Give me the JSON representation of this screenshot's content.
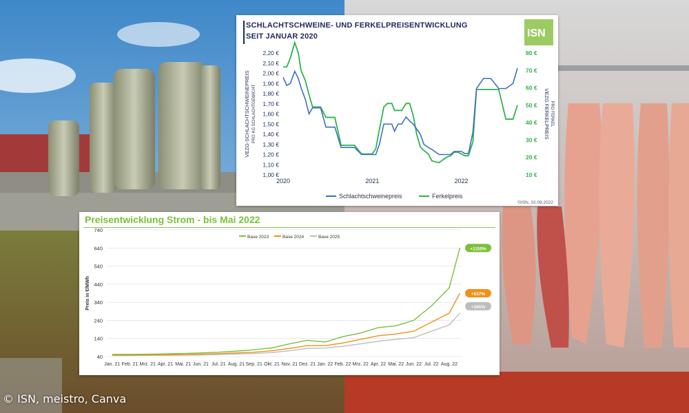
{
  "credit": "© ISN, meistro, Canva",
  "colors": {
    "blue": "#3b6fc4",
    "green": "#2db34a",
    "c2023": "#7bbf3a",
    "c2024": "#f0901a",
    "c2025": "#bdbdbd"
  },
  "chart_data": [
    {
      "type": "line",
      "title_line1": "SCHLACHTSCHWEINE- UND FERKELPREISENTWICKLUNG",
      "title_line2": "SEIT JANUAR 2020",
      "logo_text": "ISN",
      "ylabel_left": "VEZG-SCHLACHTSCHWEINEPREIS",
      "ylabel_left_sub": "PRO KG SCHLACHTGEWICHT",
      "ylabel_right": "VEZG FERKELPREIS",
      "ylabel_right_sub": "PRO FERKEL",
      "y_left_ticks": [
        "2,20 €",
        "2,10 €",
        "2,00 €",
        "1,90 €",
        "1,80 €",
        "1,70 €",
        "1,60 €",
        "1,50 €",
        "1,40 €",
        "1,30 €",
        "1,20 €",
        "1,10 €",
        "1,00 €"
      ],
      "y_right_ticks": [
        "80 €",
        "70 €",
        "60 €",
        "50 €",
        "40 €",
        "30 €",
        "20 €",
        "10 €"
      ],
      "x_ticks": [
        "2020",
        "2021",
        "2022"
      ],
      "ylim_left": [
        1.0,
        2.2
      ],
      "ylim_right": [
        10,
        80
      ],
      "legend": [
        "Schlachtschweinepreis",
        "Ferkelpreis"
      ],
      "source_note": "©ISN, 02.09.2022",
      "x": [
        2020.0,
        2020.04,
        2020.08,
        2020.13,
        2020.17,
        2020.2,
        2020.25,
        2020.29,
        2020.33,
        2020.38,
        2020.42,
        2020.48,
        2020.5,
        2020.58,
        2020.65,
        2020.7,
        2020.75,
        2020.8,
        2020.88,
        2020.92,
        2021.0,
        2021.04,
        2021.08,
        2021.13,
        2021.17,
        2021.22,
        2021.25,
        2021.29,
        2021.33,
        2021.38,
        2021.42,
        2021.46,
        2021.5,
        2021.54,
        2021.58,
        2021.63,
        2021.67,
        2021.75,
        2021.83,
        2021.88,
        2021.92,
        2021.96,
        2022.0,
        2022.04,
        2022.08,
        2022.13,
        2022.17,
        2022.25,
        2022.33,
        2022.42,
        2022.5,
        2022.58,
        2022.63
      ],
      "series": [
        {
          "name": "Schlachtschweinepreis",
          "values": [
            1.96,
            1.88,
            1.9,
            2.02,
            1.95,
            1.86,
            1.74,
            1.6,
            1.66,
            1.66,
            1.66,
            1.47,
            1.47,
            1.47,
            1.27,
            1.27,
            1.27,
            1.27,
            1.2,
            1.2,
            1.2,
            1.2,
            1.3,
            1.5,
            1.5,
            1.5,
            1.43,
            1.5,
            1.5,
            1.57,
            1.53,
            1.5,
            1.45,
            1.4,
            1.3,
            1.27,
            1.25,
            1.2,
            1.2,
            1.2,
            1.23,
            1.23,
            1.23,
            1.21,
            1.21,
            1.42,
            1.85,
            1.95,
            1.95,
            1.85,
            1.85,
            1.9,
            2.05
          ]
        },
        {
          "name": "Ferkelpreis",
          "values": [
            72,
            72,
            77,
            86,
            80,
            70,
            64,
            56,
            49,
            49,
            49,
            43,
            43,
            43,
            27,
            27,
            27,
            27,
            22,
            22,
            22,
            25,
            36,
            49,
            51,
            51,
            47,
            47,
            47,
            51,
            51,
            44,
            33,
            26,
            24,
            22,
            18,
            17,
            20,
            21,
            23,
            23,
            22,
            21,
            21,
            29,
            59,
            59,
            59,
            59,
            42,
            42,
            50
          ]
        }
      ]
    },
    {
      "type": "line",
      "title": "Preisentwicklung Strom - bis Mai 2022",
      "ylabel": "Preis in €/MWh",
      "ylim": [
        40,
        740
      ],
      "y_ticks": [
        "740",
        "640",
        "540",
        "440",
        "340",
        "240",
        "140",
        "40"
      ],
      "x_ticks": [
        "Jan. 21",
        "Feb. 21",
        "Mrz. 21",
        "Apr. 21",
        "Mai. 21",
        "Jun. 21",
        "Jul. 21",
        "Aug. 21",
        "Sep. 21",
        "Okt. 21",
        "Nov. 21",
        "Dez. 21",
        "Jan. 22",
        "Feb. 22",
        "Mrz. 22",
        "Apr. 22",
        "Mai. 22",
        "Jun. 22",
        "Jul. 22",
        "Aug. 22"
      ],
      "legend": [
        "Base 2023",
        "Base 2024",
        "Base 2025"
      ],
      "end_labels": [
        "+1155%",
        "+617%",
        "+395%"
      ],
      "x": [
        0,
        1,
        2,
        3,
        4,
        5,
        6,
        7,
        8,
        9,
        10,
        11,
        12,
        13,
        14,
        15,
        16,
        17,
        18,
        19,
        19.6
      ],
      "series": [
        {
          "name": "Base 2023",
          "values": [
            52,
            52,
            53,
            55,
            57,
            60,
            64,
            70,
            78,
            88,
            110,
            130,
            120,
            150,
            170,
            200,
            210,
            240,
            320,
            420,
            640
          ]
        },
        {
          "name": "Base 2024",
          "values": [
            48,
            48,
            49,
            50,
            51,
            53,
            56,
            60,
            64,
            72,
            85,
            100,
            100,
            115,
            135,
            155,
            165,
            180,
            230,
            280,
            390
          ]
        },
        {
          "name": "Base 2025",
          "values": [
            46,
            46,
            47,
            47,
            48,
            49,
            51,
            54,
            57,
            62,
            72,
            85,
            87,
            97,
            110,
            125,
            135,
            145,
            180,
            215,
            280
          ]
        }
      ]
    }
  ]
}
